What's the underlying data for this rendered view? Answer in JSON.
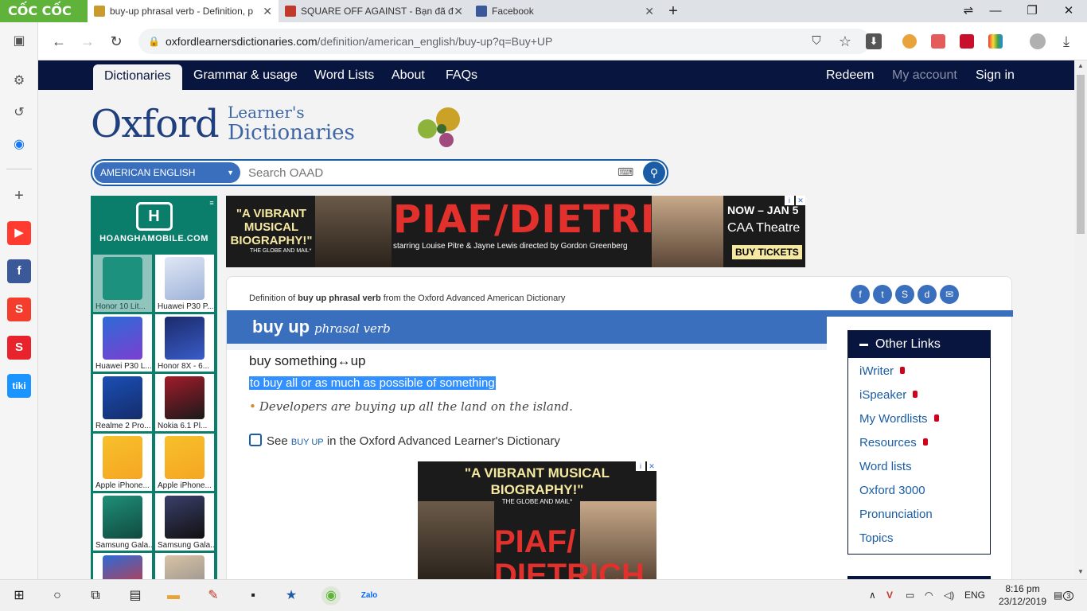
{
  "browser": {
    "brand": "CỐC CỐC",
    "tabs": [
      {
        "title": "buy-up phrasal verb - Definition, p"
      },
      {
        "title": "SQUARE OFF AGAINST - Bạn đã đ"
      },
      {
        "title": "Facebook"
      }
    ],
    "new_tab": "+",
    "url_domain": "oxfordlearnersdictionaries.com",
    "url_path": "/definition/american_english/buy-up?q=Buy+UP"
  },
  "site": {
    "nav": [
      "Dictionaries",
      "Grammar & usage",
      "Word Lists",
      "About",
      "FAQs"
    ],
    "nav_right": [
      "Redeem",
      "My account",
      "Sign in"
    ],
    "brand_main": "Oxford",
    "brand_line1": "Learner's",
    "brand_line2": "Dictionaries",
    "dictionary_select": "AMERICAN ENGLISH",
    "search_placeholder": "Search OAAD"
  },
  "left_ad": {
    "brand": "HOANGHAMOBILE.COM",
    "products": [
      "Honor 10 Lit...",
      "Huawei P30 P...",
      "Huawei P30 L...",
      "Honor 8X - 6...",
      "Realme 2 Pro...",
      "Nokia 6.1 Pl...",
      "Apple iPhone...",
      "Apple iPhone...",
      "Samsung Gala...",
      "Samsung Gala..."
    ]
  },
  "top_ad": {
    "quote": "\"A VIBRANT MUSICAL BIOGRAPHY!\"",
    "quote_src": "THE GLOBE AND MAIL*",
    "title": "PIAF/DIETRICH",
    "starring": "starring Louise Pitre & Jayne Lewis  directed by Gordon Greenberg",
    "dates": "NOW – JAN 5",
    "venue": "CAA Theatre",
    "cta": "BUY TICKETS"
  },
  "entry": {
    "def_prefix": "Definition of",
    "def_term": "buy up phrasal verb",
    "def_suffix": "from the Oxford Advanced American Dictionary",
    "headword": "buy up",
    "pos": "phrasal verb",
    "pattern": "buy something↔up",
    "definition": "to buy all or as much as possible of something",
    "example": "Developers are buying up all the land on the island.",
    "see_prefix": "See",
    "see_link": "buy up",
    "see_suffix": "in the Oxford Advanced Learner's Dictionary",
    "social_icons": [
      "facebook-icon",
      "twitter-icon",
      "stumbleupon-icon",
      "digg-icon",
      "email-icon"
    ]
  },
  "mid_ad": {
    "quote": "\"A VIBRANT MUSICAL BIOGRAPHY!\"",
    "quote_src": "THE GLOBE AND MAIL*",
    "title": "PIAF/ DIETRICH"
  },
  "other_links": {
    "title": "Other Links",
    "items": [
      {
        "label": "iWriter",
        "locked": true
      },
      {
        "label": "iSpeaker",
        "locked": true
      },
      {
        "label": "My Wordlists",
        "locked": true
      },
      {
        "label": "Resources",
        "locked": true
      },
      {
        "label": "Word lists",
        "locked": false
      },
      {
        "label": "Oxford 3000",
        "locked": false
      },
      {
        "label": "Pronunciation",
        "locked": false
      },
      {
        "label": "Topics",
        "locked": false
      }
    ]
  },
  "taskbar": {
    "lang": "ENG",
    "time": "8:16 pm",
    "date": "23/12/2019",
    "notif_count": "3"
  },
  "colors": {
    "navy": "#08153e",
    "blue": "#3a6fbd",
    "selection": "#3390ff",
    "coccoc_green": "#5fb33b"
  }
}
